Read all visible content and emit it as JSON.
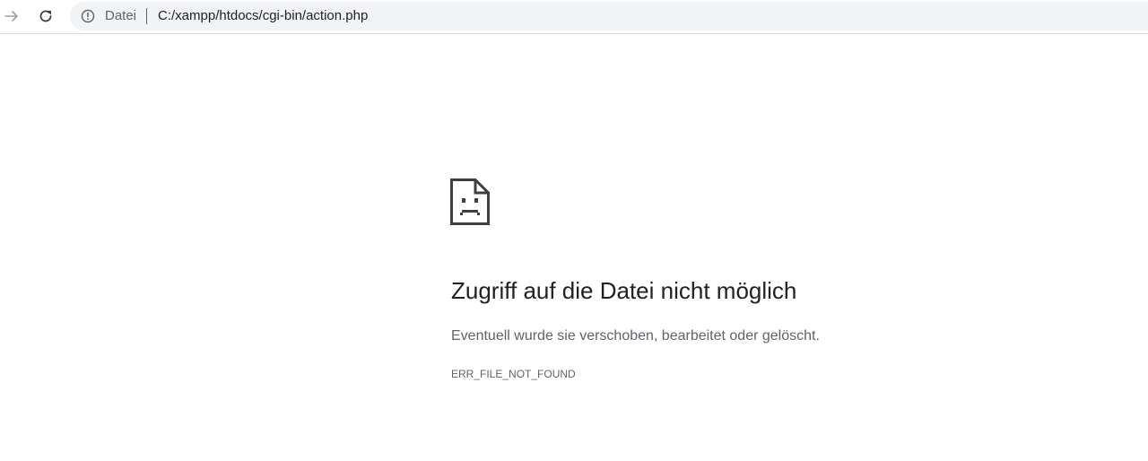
{
  "toolbar": {
    "forward_icon": "arrow-right-icon",
    "reload_icon": "reload-icon",
    "info_icon": "info-icon",
    "origin_label": "Datei",
    "url": "C:/xampp/htdocs/cgi-bin/action.php"
  },
  "error": {
    "icon": "sad-file-icon",
    "title": "Zugriff auf die Datei nicht möglich",
    "description": "Eventuell wurde sie verschoben, bearbeitet oder gelöscht.",
    "code": "ERR_FILE_NOT_FOUND"
  },
  "colors": {
    "text_primary": "#202124",
    "text_secondary": "#5f6368",
    "omnibox_bg": "#f1f3f4",
    "icon": "#3c4043"
  }
}
